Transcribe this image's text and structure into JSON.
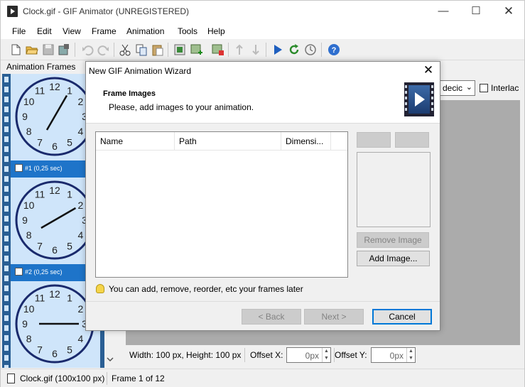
{
  "window": {
    "title": "Clock.gif - GIF Animator (UNREGISTERED)",
    "controls": {
      "minimize": "—",
      "maximize": "☐",
      "close": "✕"
    }
  },
  "menu": [
    "File",
    "Edit",
    "View",
    "Frame",
    "Animation",
    "Tools",
    "Help"
  ],
  "toolbar": {
    "icons": [
      "new-icon",
      "open-icon",
      "save-icon",
      "save-as-icon",
      "undo-icon",
      "redo-icon",
      "cut-icon",
      "copy-icon",
      "paste-icon",
      "add-frame-icon",
      "add-image-icon",
      "delete-frame-icon",
      "move-up-icon",
      "move-down-icon",
      "play-icon",
      "loop-icon",
      "timer-icon",
      "help-icon"
    ]
  },
  "frames_panel": {
    "header": "Animation Frames",
    "frames": [
      {
        "label": "#1 (0,25 sec)"
      },
      {
        "label": "#2 (0,25 sec)"
      },
      {
        "label": ""
      }
    ],
    "clock_numbers": [
      "12",
      "1",
      "2",
      "3",
      "4",
      "5",
      "6",
      "7",
      "8",
      "9",
      "10",
      "11"
    ]
  },
  "background": {
    "combo_value": "decic",
    "interlace_label": "Interlac",
    "props": {
      "size": "Width: 100 px, Height: 100 px",
      "offset_x_label": "Offset X:",
      "offset_x_value": "0px",
      "offset_y_label": "Offset Y:",
      "offset_y_value": "0px"
    }
  },
  "statusbar": {
    "file": "Clock.gif (100x100 px)",
    "frame": "Frame 1 of 12"
  },
  "dialog": {
    "title": "New GIF Animation Wizard",
    "close": "✕",
    "heading": "Frame Images",
    "subheading": "Please, add images to your animation.",
    "columns": [
      "Name",
      "Path",
      "Dimensi..."
    ],
    "remove_button": "Remove Image",
    "add_button": "Add Image...",
    "hint": "You can add, remove, reorder, etc your frames later",
    "back_button": "< Back",
    "next_button": "Next >",
    "cancel_button": "Cancel"
  },
  "colors": {
    "frames_blue": "#1e74c9",
    "frame_bg": "#cfe5fa",
    "clock_navy": "#1a2a6c"
  }
}
